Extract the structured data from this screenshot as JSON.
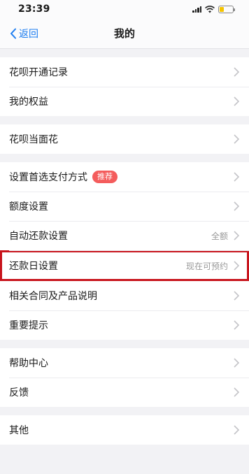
{
  "status_bar": {
    "time": "23:39",
    "icons": [
      "signal-icon",
      "wifi-icon",
      "battery-icon"
    ],
    "battery_color": "#f5c400"
  },
  "nav": {
    "back_label": "返回",
    "title": "我的",
    "accent": "#1b7cf0"
  },
  "groups": [
    {
      "items": [
        {
          "label": "花呗开通记录"
        },
        {
          "label": "我的权益"
        }
      ]
    },
    {
      "items": [
        {
          "label": "花呗当面花"
        }
      ]
    },
    {
      "items": [
        {
          "label": "设置首选支付方式",
          "badge": "推荐"
        },
        {
          "label": "额度设置"
        },
        {
          "label": "自动还款设置",
          "value": "全额"
        },
        {
          "label": "还款日设置",
          "value": "现在可预约",
          "highlighted": true
        },
        {
          "label": "相关合同及产品说明"
        },
        {
          "label": "重要提示"
        }
      ]
    },
    {
      "items": [
        {
          "label": "帮助中心"
        },
        {
          "label": "反馈"
        }
      ]
    },
    {
      "items": [
        {
          "label": "其他"
        }
      ]
    }
  ],
  "colors": {
    "badge": "#f45c5c",
    "highlight_border": "#c8141c",
    "background": "#f2f2f5"
  }
}
